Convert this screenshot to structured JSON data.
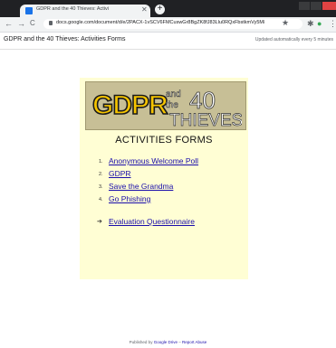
{
  "browser": {
    "tab_title": "GDPR and the 40 Thieves: Activi",
    "tab_close": "✕",
    "new_tab": "+",
    "back": "←",
    "forward": "→",
    "reload": "C",
    "url": "docs.google.com/document/d/e/2PACX-1vSCV6FMCuswGr8BgZK8fJ83Llu0RQxFbstkmVy5M8okhlSla...",
    "bookmark_icon": "star-icon",
    "extension_icons": [
      "★",
      "✱",
      "●",
      "⋮"
    ]
  },
  "header": {
    "doc_title": "GDPR and the 40 Thieves: Activities Forms",
    "update_note": "Updated automatically every 5 minutes"
  },
  "document": {
    "banner": {
      "gdpr": "GDPR",
      "and": "and",
      "the": "the",
      "number": "40",
      "thieves": "THIEVES"
    },
    "heading": "ACTIVITIES FORMS",
    "items": [
      {
        "number": "1.",
        "label": "Anonymous Welcome Poll"
      },
      {
        "number": "2.",
        "label": "GDPR"
      },
      {
        "number": "3.",
        "label": "Save the Grandma"
      },
      {
        "number": "4.",
        "label": "Go Phishing"
      }
    ],
    "extra": {
      "bullet": "➔",
      "label": "Evaluation Questionnaire"
    }
  },
  "footer": {
    "published_by": "Published by",
    "google_drive": "Google Drive",
    "separator": "–",
    "report_abuse": "Report Abuse"
  },
  "colors": {
    "page_bg": "#fffed4",
    "link": "#1a0dab",
    "banner_bg": "#c7bf96",
    "gdpr_fill": "#f5c400"
  }
}
